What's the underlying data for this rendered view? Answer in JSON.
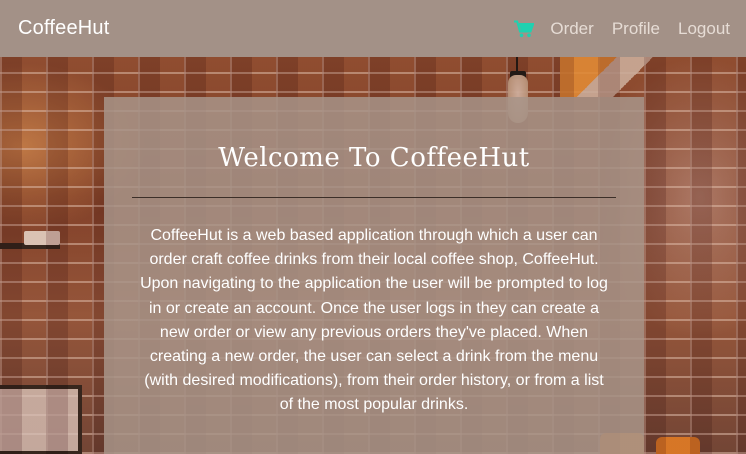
{
  "navbar": {
    "brand": "CoffeeHut",
    "cart_icon": "shopping-cart-icon",
    "cart_color": "#1fd1b0",
    "links": [
      "Order",
      "Profile",
      "Logout"
    ]
  },
  "card": {
    "title": "Welcome To CoffeeHut",
    "body": "CoffeeHut is a web based application through which a user can order craft coffee drinks from their local coffee shop, CoffeeHut. Upon navigating to the application the user will be prompted to log in or create an account. Once the user logs in they can create a new order or view any previous orders they've placed. When creating a new order, the user can select a drink from the menu (with desired modifications), from their order history, or from a list of the most popular drinks."
  },
  "colors": {
    "navbar_bg": "#a39187",
    "card_bg": "#a89488",
    "accent": "#1fd1b0"
  }
}
